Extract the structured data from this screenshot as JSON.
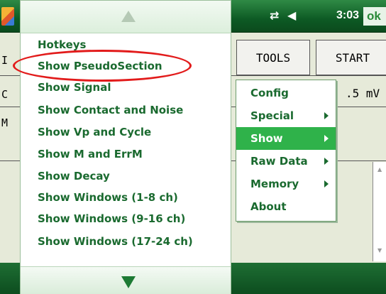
{
  "status": {
    "sync_icon": "⇄",
    "volume_icon": "◀",
    "time": "3:03",
    "ok_label": "ok"
  },
  "toolbar": {
    "tools_label": "TOOLS",
    "start_label": "START"
  },
  "background": {
    "voltage_text": ".5 mV",
    "left_letter_1": "I",
    "left_letter_2": "C",
    "left_letter_3": "M"
  },
  "main_menu": {
    "items": [
      {
        "label": "Hotkeys"
      },
      {
        "label": "Show PseudoSection"
      },
      {
        "label": "Show Signal"
      },
      {
        "label": "Show Contact and Noise"
      },
      {
        "label": "Show Vp and Cycle"
      },
      {
        "label": "Show M and ErrM"
      },
      {
        "label": "Show Decay"
      },
      {
        "label": "Show Windows (1-8 ch)"
      },
      {
        "label": "Show Windows (9-16 ch)"
      },
      {
        "label": "Show Windows (17-24 ch)"
      }
    ],
    "scroll_up_icon": "scroll-up-arrow",
    "scroll_down_icon": "scroll-down-arrow"
  },
  "sub_menu": {
    "items": [
      {
        "label": "Config",
        "has_submenu": false,
        "selected": false
      },
      {
        "label": "Special",
        "has_submenu": true,
        "selected": false
      },
      {
        "label": "Show",
        "has_submenu": true,
        "selected": true
      },
      {
        "label": "Raw Data",
        "has_submenu": true,
        "selected": false
      },
      {
        "label": "Memory",
        "has_submenu": true,
        "selected": false
      },
      {
        "label": "About",
        "has_submenu": false,
        "selected": false
      }
    ]
  },
  "colors": {
    "menu_text": "#1a6a2f",
    "selected_bg": "#2fb24a",
    "highlight_ellipse": "#e21b1b",
    "titlebar": "#0d5a24"
  }
}
